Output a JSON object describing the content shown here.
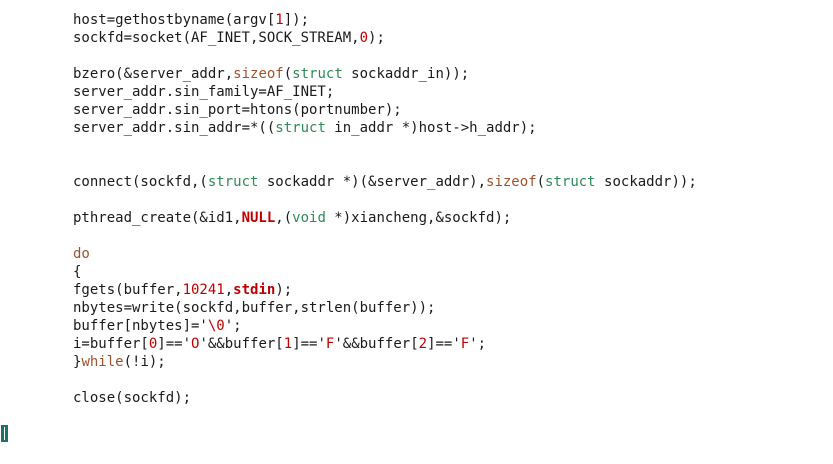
{
  "editor": {
    "lines": [
      [
        {
          "t": "host=gethostbyname(argv[",
          "c": "plain"
        },
        {
          "t": "1",
          "c": "num"
        },
        {
          "t": "]);",
          "c": "plain"
        }
      ],
      [
        {
          "t": "sockfd=socket(AF_INET,SOCK_STREAM,",
          "c": "plain"
        },
        {
          "t": "0",
          "c": "num"
        },
        {
          "t": ");",
          "c": "plain"
        }
      ],
      [],
      [
        {
          "t": "bzero(&server_addr,",
          "c": "plain"
        },
        {
          "t": "sizeof",
          "c": "kw"
        },
        {
          "t": "(",
          "c": "plain"
        },
        {
          "t": "struct",
          "c": "type"
        },
        {
          "t": " sockaddr_in));",
          "c": "plain"
        }
      ],
      [
        {
          "t": "server_addr.sin_family=AF_INET;",
          "c": "plain"
        }
      ],
      [
        {
          "t": "server_addr.sin_port=htons(portnumber);",
          "c": "plain"
        }
      ],
      [
        {
          "t": "server_addr.sin_addr=*((",
          "c": "plain"
        },
        {
          "t": "struct",
          "c": "type"
        },
        {
          "t": " in_addr *)host->h_addr);",
          "c": "plain"
        }
      ],
      [],
      [],
      [
        {
          "t": "connect(sockfd,(",
          "c": "plain"
        },
        {
          "t": "struct",
          "c": "type"
        },
        {
          "t": " sockaddr *)(&server_addr),",
          "c": "plain"
        },
        {
          "t": "sizeof",
          "c": "kw"
        },
        {
          "t": "(",
          "c": "plain"
        },
        {
          "t": "struct",
          "c": "type"
        },
        {
          "t": " sockaddr));",
          "c": "plain"
        }
      ],
      [],
      [
        {
          "t": "pthread_create(&id1,",
          "c": "plain"
        },
        {
          "t": "NULL",
          "c": "const"
        },
        {
          "t": ",(",
          "c": "plain"
        },
        {
          "t": "void",
          "c": "type"
        },
        {
          "t": " *)xiancheng,&sockfd);",
          "c": "plain"
        }
      ],
      [],
      [
        {
          "t": "do",
          "c": "kw"
        }
      ],
      [
        {
          "t": "{",
          "c": "plain"
        }
      ],
      [
        {
          "t": "fgets(buffer,",
          "c": "plain"
        },
        {
          "t": "10241",
          "c": "num"
        },
        {
          "t": ",",
          "c": "plain"
        },
        {
          "t": "stdin",
          "c": "const"
        },
        {
          "t": ");",
          "c": "plain"
        }
      ],
      [
        {
          "t": "nbytes=write(sockfd,buffer,strlen(buffer));",
          "c": "plain"
        }
      ],
      [
        {
          "t": "buffer[nbytes]='",
          "c": "plain"
        },
        {
          "t": "\\0",
          "c": "str"
        },
        {
          "t": "';",
          "c": "plain"
        }
      ],
      [
        {
          "t": "i=buffer[",
          "c": "plain"
        },
        {
          "t": "0",
          "c": "num"
        },
        {
          "t": "]=='",
          "c": "plain"
        },
        {
          "t": "O",
          "c": "str"
        },
        {
          "t": "'&&buffer[",
          "c": "plain"
        },
        {
          "t": "1",
          "c": "num"
        },
        {
          "t": "]=='",
          "c": "plain"
        },
        {
          "t": "F",
          "c": "str"
        },
        {
          "t": "'&&buffer[",
          "c": "plain"
        },
        {
          "t": "2",
          "c": "num"
        },
        {
          "t": "]=='",
          "c": "plain"
        },
        {
          "t": "F",
          "c": "str"
        },
        {
          "t": "';",
          "c": "plain"
        }
      ],
      [
        {
          "t": "}",
          "c": "plain"
        },
        {
          "t": "while",
          "c": "kw"
        },
        {
          "t": "(!i);",
          "c": "plain"
        }
      ],
      [],
      [
        {
          "t": "close(sockfd);",
          "c": "plain"
        }
      ]
    ]
  },
  "colors": {
    "background": "#ffffff",
    "text": "#1a1a1a",
    "keyword": "#a0522d",
    "type": "#2e8b57",
    "number": "#c00000",
    "cursor": "#1f6f6f"
  }
}
